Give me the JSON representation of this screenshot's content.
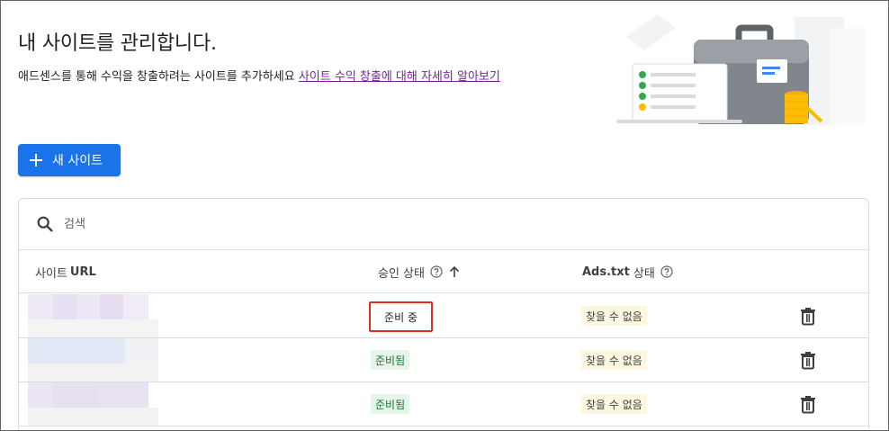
{
  "header": {
    "title": "내 사이트를 관리합니다.",
    "subtitle": "애드센스를 통해 수익을 창출하려는 사이트를 추가하세요",
    "learn_more_link": "사이트 수익 창출에 대해 자세히 알아보기"
  },
  "new_site_button": {
    "label": "새 사이트",
    "icon": "plus-icon"
  },
  "search": {
    "placeholder": "검색",
    "icon": "search-icon"
  },
  "table": {
    "columns": {
      "site_url_prefix": "사이트",
      "site_url_bold": "URL",
      "approval_status": "승인 상태",
      "ads_txt_prefix": "Ads.txt",
      "ads_txt_suffix": "상태"
    },
    "sort_icon": "arrow-up-icon",
    "help_icon": "help-circle-icon",
    "rows": [
      {
        "approval": "준비 중",
        "ads_txt": "찾을 수 없음",
        "delete_icon": "trash-icon"
      },
      {
        "approval": "준비됨",
        "ads_txt": "찾을 수 없음",
        "delete_icon": "trash-icon"
      },
      {
        "approval": "준비됨",
        "ads_txt": "찾을 수 없음",
        "delete_icon": "trash-icon"
      }
    ]
  },
  "colors": {
    "primary": "#1a73e8",
    "link": "#7b1fa2",
    "ready_bg": "#e6f4ea",
    "ready_text": "#137333",
    "warn_bg": "#fef7e0",
    "highlight_border": "#d93025"
  }
}
